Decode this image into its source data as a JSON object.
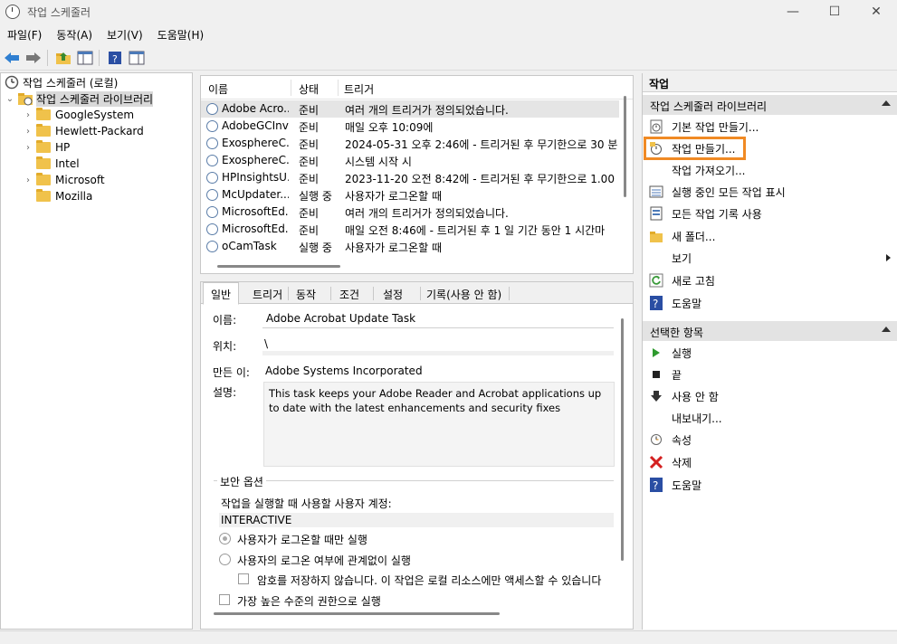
{
  "window": {
    "title": "작업 스케줄러"
  },
  "menu": [
    "파일(F)",
    "동작(A)",
    "보기(V)",
    "도움말(H)"
  ],
  "tree": {
    "root": "작업 스케줄러 (로컬)",
    "library": "작업 스케줄러 라이브러리",
    "folders": [
      "GoogleSystem",
      "Hewlett-Packard",
      "HP",
      "Intel",
      "Microsoft",
      "Mozilla"
    ]
  },
  "task_list": {
    "headers": [
      "이름",
      "상태",
      "트리거"
    ],
    "rows": [
      {
        "name": "Adobe Acro...",
        "status": "준비",
        "trigger": "여러 개의 트리거가 정의되었습니다."
      },
      {
        "name": "AdobeGCInv...",
        "status": "준비",
        "trigger": "매일 오후 10:09에"
      },
      {
        "name": "ExosphereC...",
        "status": "준비",
        "trigger": "2024-05-31 오후 2:46에 - 트리거된 후 무기한으로 30 분"
      },
      {
        "name": "ExosphereC...",
        "status": "준비",
        "trigger": "시스템 시작 시"
      },
      {
        "name": "HPInsightsU...",
        "status": "준비",
        "trigger": "2023-11-20 오전 8:42에 - 트리거된 후 무기한으로 1.00"
      },
      {
        "name": "McUpdater...",
        "status": "실행 중",
        "trigger": "사용자가 로그온할 때"
      },
      {
        "name": "MicrosoftEd...",
        "status": "준비",
        "trigger": "여러 개의 트리거가 정의되었습니다."
      },
      {
        "name": "MicrosoftEd...",
        "status": "준비",
        "trigger": "매일 오전 8:46에 - 트리거된 후 1 일 기간 동안 1 시간마"
      },
      {
        "name": "oCamTask",
        "status": "실행 중",
        "trigger": "사용자가 로그온할 때"
      }
    ]
  },
  "detail": {
    "tabs": [
      "일반",
      "트리거",
      "동작",
      "조건",
      "설정",
      "기록(사용 안 함)"
    ],
    "name_label": "이름:",
    "name_value": "Adobe Acrobat Update Task",
    "location_label": "위치:",
    "location_value": "\\",
    "author_label": "만든 이:",
    "author_value": "Adobe Systems Incorporated",
    "desc_label": "설명:",
    "desc_value": "This task keeps your Adobe Reader and Acrobat applications up to date with the latest enhancements and security fixes",
    "security_group": "보안 옵션",
    "run_as_label": "작업을 실행할 때 사용할 사용자 계정:",
    "run_as_value": "INTERACTIVE",
    "radio_logon_only": "사용자가 로그온할 때만 실행",
    "radio_any": "사용자의 로그온 여부에 관계없이 실행",
    "check_no_password": "암호를 저장하지 않습니다. 이 작업은 로컬 리소스에만 액세스할 수 있습니다",
    "check_highest": "가장 높은 수준의 권한으로 실행"
  },
  "actions": {
    "title": "작업",
    "library_section": "작업 스케줄러 라이브러리",
    "library_items": [
      "기본 작업 만들기...",
      "작업 만들기...",
      "작업 가져오기...",
      "실행 중인 모든 작업 표시",
      "모든 작업 기록 사용",
      "새 폴더...",
      "보기",
      "새로 고침",
      "도움말"
    ],
    "selected_section": "선택한 항목",
    "selected_items": [
      "실행",
      "끝",
      "사용 안 함",
      "내보내기...",
      "속성",
      "삭제",
      "도움말"
    ]
  }
}
